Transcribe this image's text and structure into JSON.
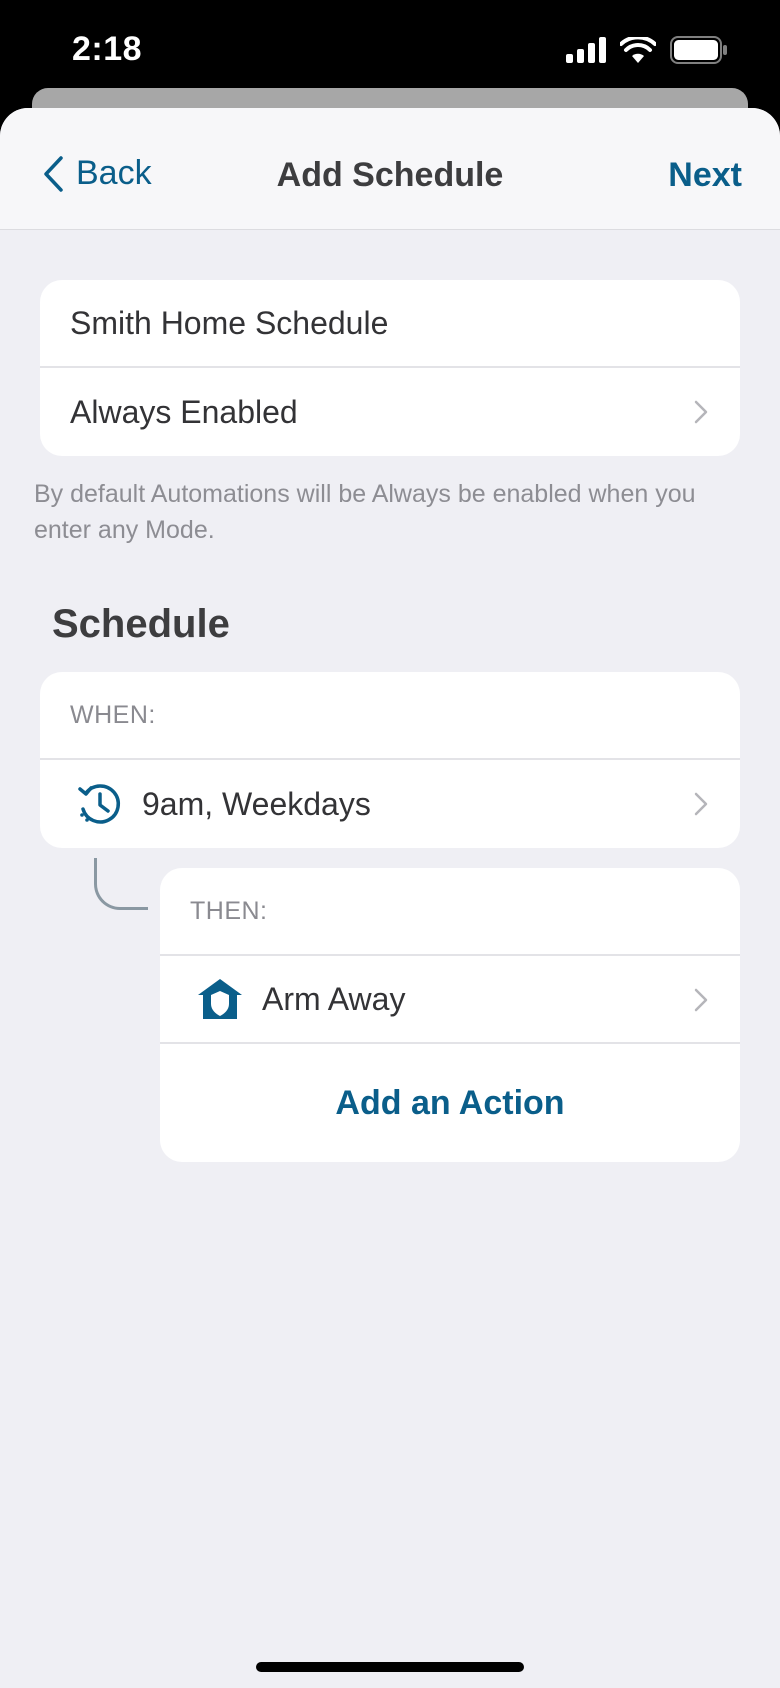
{
  "status": {
    "time": "2:18"
  },
  "nav": {
    "back_label": "Back",
    "title": "Add Schedule",
    "next_label": "Next"
  },
  "general": {
    "name_value": "Smith Home Schedule",
    "enabled_label": "Always Enabled",
    "caption": "By default Automations will be Always be enabled when you enter any Mode."
  },
  "schedule": {
    "section_title": "Schedule",
    "when_label": "WHEN:",
    "when_value": "9am, Weekdays",
    "then_label": "THEN:",
    "action_label": "Arm Away",
    "add_action_label": "Add an Action"
  },
  "colors": {
    "accent": "#0a5e8a",
    "background": "#efeff4"
  },
  "icons": [
    "chevron-left-icon",
    "chevron-right-icon",
    "clock-history-icon",
    "home-shield-icon",
    "signal-icon",
    "wifi-icon",
    "battery-icon"
  ]
}
